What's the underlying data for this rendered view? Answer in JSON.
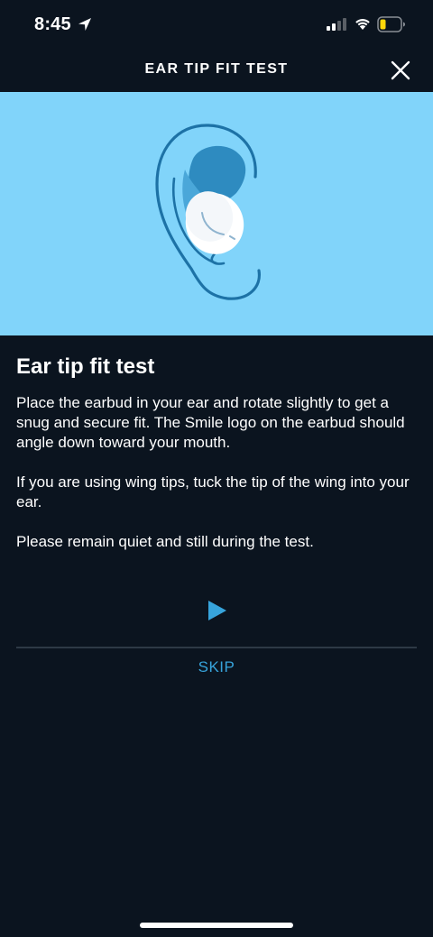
{
  "status_bar": {
    "time": "8:45",
    "location_icon": "location-arrow-icon",
    "signal_icon": "cellular-signal-icon",
    "wifi_icon": "wifi-icon",
    "battery_icon": "battery-low-icon",
    "battery_color": "#ffd60a"
  },
  "nav": {
    "title": "EAR TIP FIT TEST",
    "close_icon": "close-icon"
  },
  "illustration": {
    "background": "#81d4fa",
    "subject": "ear-with-earbud"
  },
  "content": {
    "heading": "Ear tip fit test",
    "paragraphs": [
      "Place the earbud in your ear and rotate slightly to get a snug and secure fit. The Smile logo on the earbud should angle down toward your mouth.",
      "If you are using wing tips, tuck the tip of the wing into your ear.",
      "Please remain quiet and still during the test."
    ]
  },
  "actions": {
    "play_icon": "play-icon",
    "skip_label": "SKIP",
    "accent_color": "#37a4dc"
  }
}
